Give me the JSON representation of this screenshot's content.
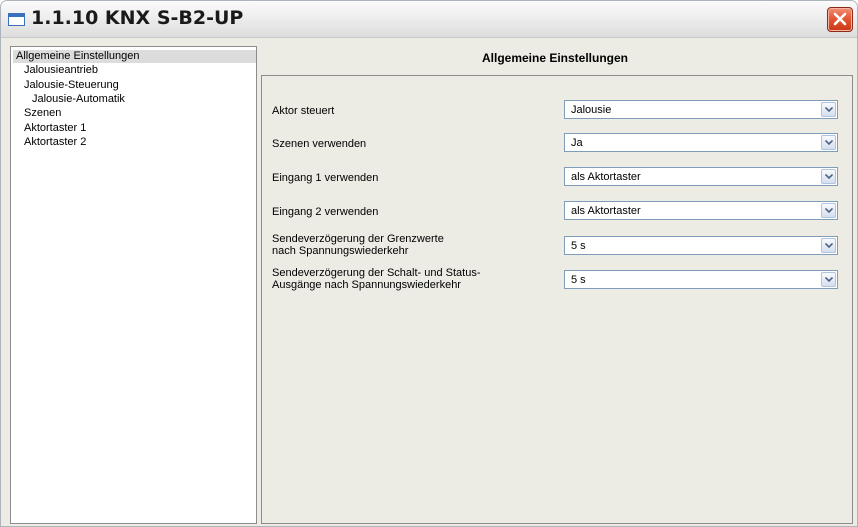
{
  "window": {
    "title": "1.1.10 KNX S-B2-UP"
  },
  "tree": {
    "items": [
      {
        "label": "Allgemeine Einstellungen",
        "selected": true
      },
      {
        "label": "Jalousieantrieb"
      },
      {
        "label": "Jalousie-Steuerung"
      },
      {
        "label": "Jalousie-Automatik"
      },
      {
        "label": "Szenen"
      },
      {
        "label": "Aktortaster 1"
      },
      {
        "label": "Aktortaster 2"
      }
    ]
  },
  "panel": {
    "title": "Allgemeine Einstellungen",
    "params": [
      {
        "label_lines": [
          "Aktor steuert"
        ],
        "value": "Jalousie"
      },
      {
        "label_lines": [
          "Szenen verwenden"
        ],
        "value": "Ja"
      },
      {
        "label_lines": [
          "Eingang 1 verwenden"
        ],
        "value": "als Aktortaster"
      },
      {
        "label_lines": [
          "Eingang 2 verwenden"
        ],
        "value": "als Aktortaster"
      },
      {
        "label_lines": [
          "Sendeverzögerung der Grenzwerte",
          "nach Spannungswiederkehr"
        ],
        "value": "5 s"
      },
      {
        "label_lines": [
          "Sendeverzögerung der Schalt- und Status-",
          "Ausgänge nach Spannungswiederkehr"
        ],
        "value": "5 s"
      }
    ]
  },
  "colors": {
    "selection": "#dcdcdc",
    "close_button": "#e2532f",
    "dropdown_border": "#7f9db9"
  }
}
